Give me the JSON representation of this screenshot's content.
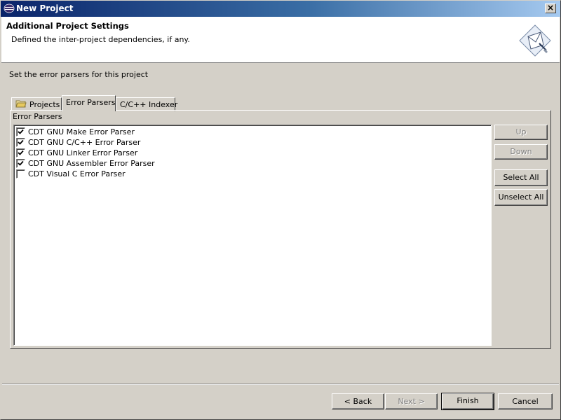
{
  "window": {
    "title": "New Project",
    "close_label": "×"
  },
  "banner": {
    "title": "Additional Project Settings",
    "description": "Defined the inter-project dependencies, if any."
  },
  "instruction": "Set the error parsers for this project",
  "tabs": [
    {
      "label": "Projects",
      "icon": "folder-icon",
      "selected": false
    },
    {
      "label": "Error Parsers",
      "selected": true
    },
    {
      "label": "C/C++ Indexer",
      "selected": false
    }
  ],
  "group_label": "Error Parsers",
  "parsers": [
    {
      "label": "CDT GNU Make Error Parser",
      "checked": true
    },
    {
      "label": "CDT GNU C/C++ Error Parser",
      "checked": true
    },
    {
      "label": "CDT GNU Linker Error Parser",
      "checked": true
    },
    {
      "label": "CDT GNU Assembler Error Parser",
      "checked": true
    },
    {
      "label": "CDT Visual C Error Parser",
      "checked": false
    }
  ],
  "side_buttons": {
    "up": "Up",
    "down": "Down",
    "select_all": "Select All",
    "unselect_all": "Unselect All"
  },
  "footer_buttons": {
    "back": "< Back",
    "next": "Next >",
    "finish": "Finish",
    "cancel": "Cancel"
  }
}
